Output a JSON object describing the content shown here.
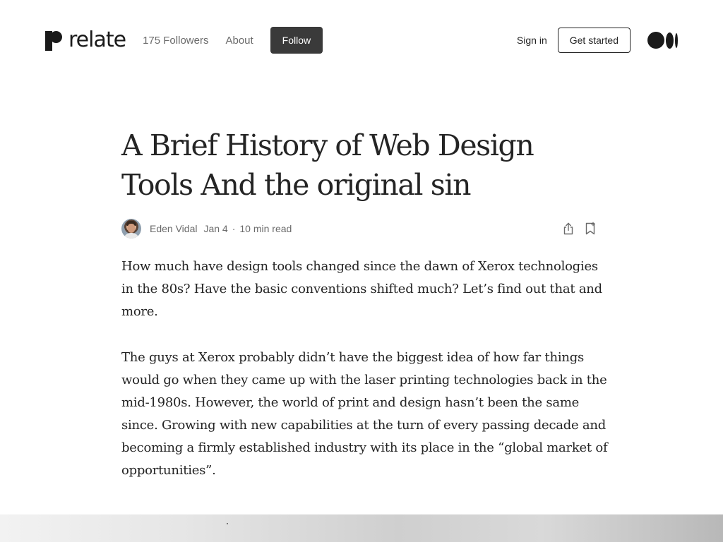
{
  "header": {
    "brand_name": "relate",
    "followers_label": "175 Followers",
    "about_label": "About",
    "follow_label": "Follow",
    "signin_label": "Sign in",
    "get_started_label": "Get started"
  },
  "article": {
    "title": "A Brief History of Web Design Tools And the original sin",
    "author": "Eden Vidal",
    "date": "Jan 4",
    "separator": "·",
    "read_time": "10 min read",
    "paragraphs": [
      "How much have design tools changed since the dawn of Xerox technologies in the 80s? Have the basic conventions shifted much? Let’s find out that and more.",
      "The guys at Xerox probably didn’t have the biggest idea of how far things would go when they came up with the laser printing technologies back in the mid-1980s. However, the world of print and design hasn’t been the same since. Growing with new capabilities at the turn of every passing decade and becoming a firmly established industry with its place in the “global market of opportunities”."
    ]
  },
  "icons": {
    "share": "share-icon",
    "bookmark": "bookmark-icon",
    "medium": "medium-logo-icon"
  }
}
